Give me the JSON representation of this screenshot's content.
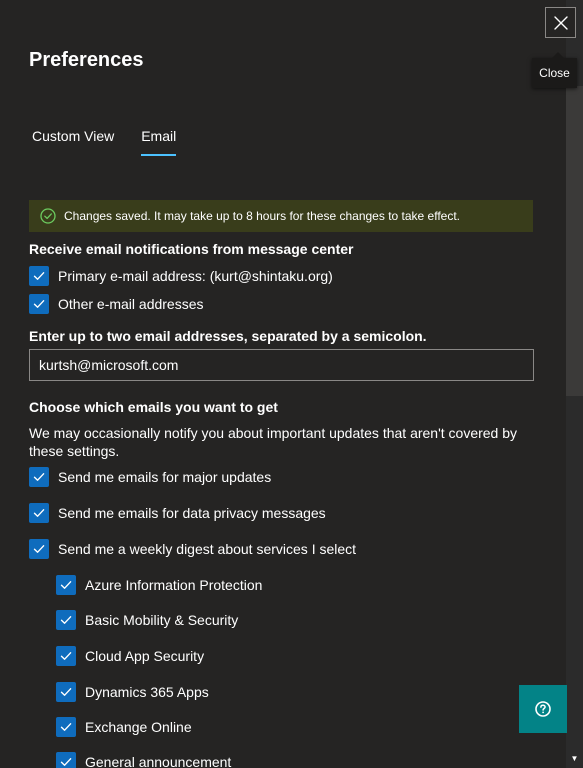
{
  "panel": {
    "title": "Preferences",
    "close_tooltip": "Close"
  },
  "tabs": [
    {
      "label": "Custom View",
      "active": false
    },
    {
      "label": "Email",
      "active": true
    }
  ],
  "banner": {
    "text": "Changes saved. It may take up to 8 hours for these changes to take effect."
  },
  "notifications": {
    "heading": "Receive email notifications from message center",
    "primary_label": "Primary e-mail address: (kurt@shintaku.org)",
    "other_label": "Other e-mail addresses"
  },
  "email_entry": {
    "label": "Enter up to two email addresses, separated by a semicolon.",
    "value": "kurtsh@microsoft.com"
  },
  "choose": {
    "heading": "Choose which emails you want to get",
    "description": "We may occasionally notify you about important updates that aren't covered by these settings.",
    "options": [
      "Send me emails for major updates",
      "Send me emails for data privacy messages",
      "Send me a weekly digest about services I select"
    ],
    "services": [
      "Azure Information Protection",
      "Basic Mobility & Security",
      "Cloud App Security",
      "Dynamics 365 Apps",
      "Exchange Online",
      "General announcement"
    ]
  },
  "colors": {
    "accent": "#4cc2ff",
    "checkbox": "#0f6cbd",
    "success_bg": "#393d1b",
    "success_icon": "#6ccb5f",
    "help_button": "#038387"
  },
  "icons": {
    "close": "close-icon",
    "success": "checkmark-circle-icon",
    "check": "checkmark-icon",
    "help": "question-icon"
  }
}
